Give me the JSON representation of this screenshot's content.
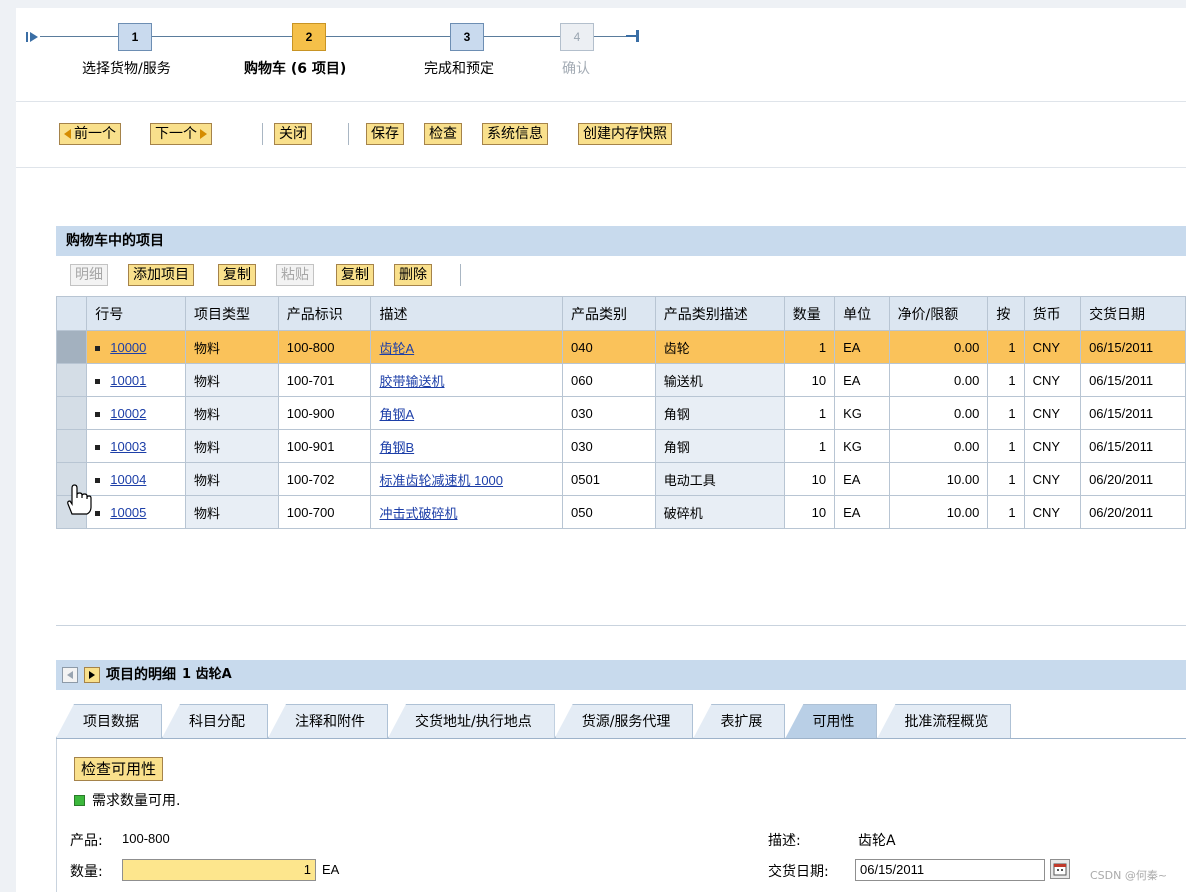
{
  "roadmap": {
    "steps": [
      {
        "num": "1",
        "label": "选择货物/服务"
      },
      {
        "num": "2",
        "label": "购物车 (6 项目)"
      },
      {
        "num": "3",
        "label": "完成和预定"
      },
      {
        "num": "4",
        "label": "确认"
      }
    ]
  },
  "toolbar": {
    "prev": "前一个",
    "next": "下一个",
    "close": "关闭",
    "save": "保存",
    "check": "检查",
    "sysinfo": "系统信息",
    "snapshot": "创建内存快照"
  },
  "items_panel": {
    "title": "购物车中的项目",
    "buttons": {
      "details": "明细",
      "add_item": "添加项目",
      "copy1": "复制",
      "paste": "粘贴",
      "copy2": "复制",
      "delete": "删除"
    },
    "columns": [
      "行号",
      "项目类型",
      "产品标识",
      "描述",
      "产品类别",
      "产品类别描述",
      "数量",
      "单位",
      "净价/限额",
      "按",
      "货币",
      "交货日期"
    ],
    "rows": [
      {
        "line": "10000",
        "type": "物料",
        "product": "100-800",
        "desc": "齿轮A",
        "cat": "040",
        "cat_desc": "齿轮",
        "qty": "1",
        "unit": "EA",
        "price": "0.00",
        "per": "1",
        "currency": "CNY",
        "date": "06/15/2011"
      },
      {
        "line": "10001",
        "type": "物料",
        "product": "100-701",
        "desc": "胶带输送机",
        "cat": "060",
        "cat_desc": "输送机",
        "qty": "10",
        "unit": "EA",
        "price": "0.00",
        "per": "1",
        "currency": "CNY",
        "date": "06/15/2011"
      },
      {
        "line": "10002",
        "type": "物料",
        "product": "100-900",
        "desc": "角钢A",
        "cat": "030",
        "cat_desc": "角钢",
        "qty": "1",
        "unit": "KG",
        "price": "0.00",
        "per": "1",
        "currency": "CNY",
        "date": "06/15/2011"
      },
      {
        "line": "10003",
        "type": "物料",
        "product": "100-901",
        "desc": "角钢B",
        "cat": "030",
        "cat_desc": "角钢",
        "qty": "1",
        "unit": "KG",
        "price": "0.00",
        "per": "1",
        "currency": "CNY",
        "date": "06/15/2011"
      },
      {
        "line": "10004",
        "type": "物料",
        "product": "100-702",
        "desc": "标准齿轮减速机 1000",
        "cat": "0501",
        "cat_desc": "电动工具",
        "qty": "10",
        "unit": "EA",
        "price": "10.00",
        "per": "1",
        "currency": "CNY",
        "date": "06/20/2011"
      },
      {
        "line": "10005",
        "type": "物料",
        "product": "100-700",
        "desc": "冲击式破碎机",
        "cat": "050",
        "cat_desc": "破碎机",
        "qty": "10",
        "unit": "EA",
        "price": "10.00",
        "per": "1",
        "currency": "CNY",
        "date": "06/20/2011"
      }
    ]
  },
  "detail": {
    "title": "项目的明细",
    "subtitle": "1 齿轮A",
    "tabs": [
      "项目数据",
      "科目分配",
      "注释和附件",
      "交货地址/执行地点",
      "货源/服务代理",
      "表扩展",
      "可用性",
      "批准流程概览"
    ],
    "active_tab": "可用性",
    "check_button": "检查可用性",
    "status_text": "需求数量可用.",
    "product_label": "产品:",
    "product_value": "100-800",
    "qty_label": "数量:",
    "qty_value": "1",
    "qty_unit": "EA",
    "desc_label": "描述:",
    "desc_value": "齿轮A",
    "date_label": "交货日期:",
    "date_value": "06/15/2011"
  },
  "watermark": "CSDN @何秦~",
  "colors": {
    "accent_button": "#f9e08c",
    "header_blue": "#c8daed",
    "highlight_row": "#fac25a",
    "status_green": "#3cb83c"
  }
}
